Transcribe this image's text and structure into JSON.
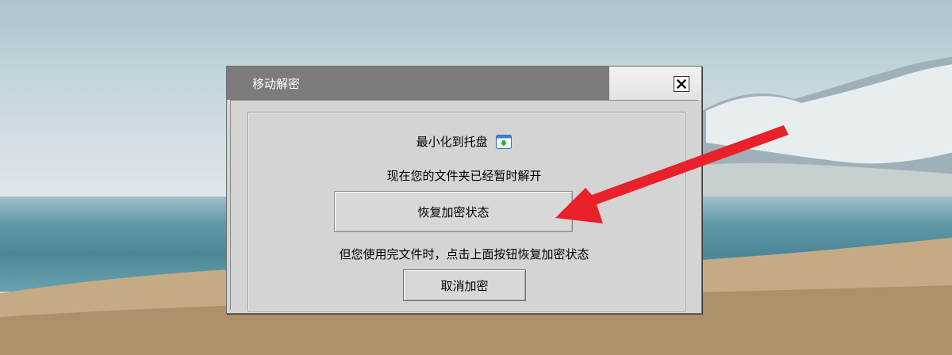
{
  "dialog": {
    "title": "移动解密",
    "close_icon": "close-icon",
    "minimize_label": "最小化到托盘",
    "tray_icon": "minimize-to-tray-icon",
    "status_text": "现在您的文件夹已经暂时解开",
    "restore_button_label": "恢复加密状态",
    "hint_text": "但您使用完文件时，点击上面按钮恢复加密状态",
    "cancel_button_label": "取消加密"
  },
  "annotation": {
    "arrow_color": "#e8212b",
    "arrow_icon": "red-annotation-arrow"
  },
  "colors": {
    "titlebar": "#7c7c7c",
    "dialog_background": "#d4d4d4"
  }
}
